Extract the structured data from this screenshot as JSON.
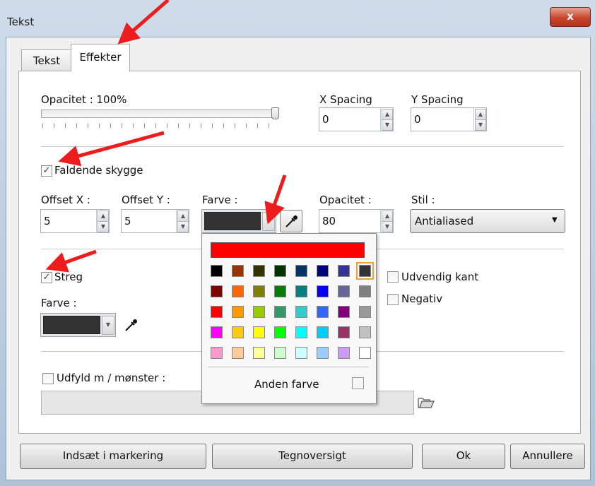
{
  "window": {
    "title": "Tekst",
    "close_label": "x"
  },
  "tabs": [
    {
      "label": "Tekst"
    },
    {
      "label": "Effekter"
    }
  ],
  "opacity": {
    "label": "Opacitet : 100%"
  },
  "x_spacing": {
    "label": "X Spacing",
    "value": "0"
  },
  "y_spacing": {
    "label": "Y Spacing",
    "value": "0"
  },
  "shadow": {
    "checkbox_label": "Faldende skygge",
    "offset_x": {
      "label": "Offset X :",
      "value": "5"
    },
    "offset_y": {
      "label": "Offset Y :",
      "value": "5"
    },
    "color_label": "Farve :",
    "opacity": {
      "label": "Opacitet :",
      "value": "80"
    },
    "style": {
      "label": "Stil :",
      "value": "Antialiased"
    }
  },
  "stroke": {
    "checkbox_label": "Streg",
    "color_label": "Farve :"
  },
  "outer_edge_label": "Udvendig kant",
  "negative_label": "Negativ",
  "fill_pattern_label": "Udfyld m / mønster :",
  "popup": {
    "other_color_label": "Anden farve",
    "top_color": "#ff0000",
    "palette": [
      [
        "#000000",
        "#993300",
        "#333300",
        "#003300",
        "#003366",
        "#000080",
        "#333399",
        "#333333"
      ],
      [
        "#800000",
        "#ff6600",
        "#808000",
        "#008000",
        "#008080",
        "#0000ff",
        "#666699",
        "#808080"
      ],
      [
        "#ff0000",
        "#ff9900",
        "#99cc00",
        "#339966",
        "#33cccc",
        "#3366ff",
        "#800080",
        "#999999"
      ],
      [
        "#ff00ff",
        "#ffcc00",
        "#ffff00",
        "#00ff00",
        "#00ffff",
        "#00ccff",
        "#993366",
        "#c0c0c0"
      ],
      [
        "#ff99cc",
        "#ffcc99",
        "#ffff99",
        "#ccffcc",
        "#ccffff",
        "#99ccff",
        "#cc99ff",
        "#ffffff"
      ]
    ]
  },
  "buttons": {
    "insert": "Indsæt i markering",
    "charmap": "Tegnoversigt",
    "ok": "Ok",
    "cancel": "Annullere"
  },
  "colors": {
    "annotation_arrow": "#ee1c1c",
    "selected_swatch_border": "#e8a33a"
  }
}
